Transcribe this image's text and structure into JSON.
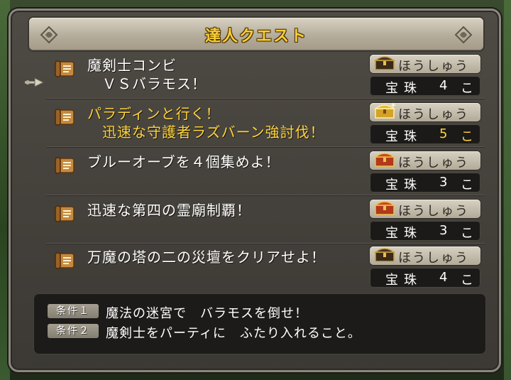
{
  "title": "達人クエスト",
  "quests": [
    {
      "line1": "魔剣士コンビ",
      "line2": "　ＶＳバラモス！",
      "highlight": false,
      "chest": "treasure-chest-dark",
      "reward_label": "ほうしゅう",
      "gem_label": "宝珠",
      "count": "4",
      "unit": "こ"
    },
    {
      "line1": "パラディンと行く！",
      "line2": "　迅速な守護者ラズバーン強討伐！",
      "highlight": true,
      "chest": "treasure-chest-gold",
      "reward_label": "ほうしゅう",
      "gem_label": "宝珠",
      "count": "5",
      "unit": "こ"
    },
    {
      "line1": "ブルーオーブを４個集めよ！",
      "line2": "",
      "highlight": false,
      "chest": "treasure-chest-red",
      "reward_label": "ほうしゅう",
      "gem_label": "宝珠",
      "count": "3",
      "unit": "こ"
    },
    {
      "line1": "迅速な第四の霊廟制覇！",
      "line2": "",
      "highlight": false,
      "chest": "treasure-chest-red",
      "reward_label": "ほうしゅう",
      "gem_label": "宝珠",
      "count": "3",
      "unit": "こ"
    },
    {
      "line1": "万魔の塔の二の災壇をクリアせよ！",
      "line2": "",
      "highlight": false,
      "chest": "treasure-chest-dark",
      "reward_label": "ほうしゅう",
      "gem_label": "宝珠",
      "count": "4",
      "unit": "こ"
    }
  ],
  "conditions": [
    {
      "tag": "条件１",
      "text": "魔法の迷宮で　バラモスを倒せ！"
    },
    {
      "tag": "条件２",
      "text": "魔剣士をパーティに　ふたり入れること。"
    }
  ],
  "colors": {
    "highlight": "#ffd43a",
    "title": "#f7cf39",
    "panel": "#3c3934"
  }
}
